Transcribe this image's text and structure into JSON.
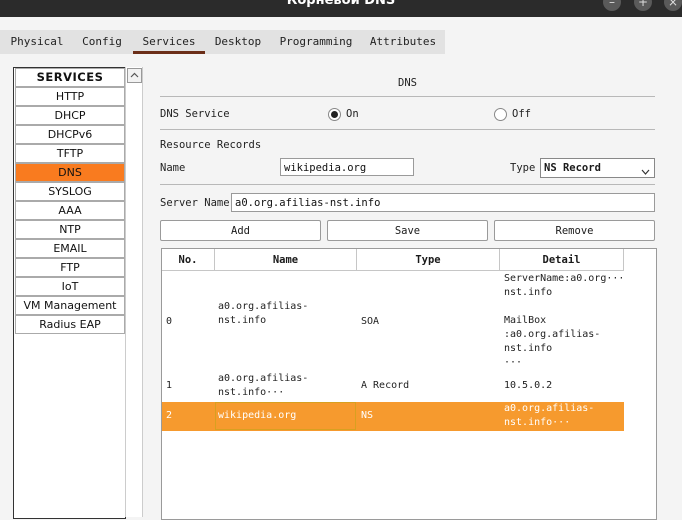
{
  "window": {
    "title": "Корневой DNS"
  },
  "tabs": [
    "Physical",
    "Config",
    "Services",
    "Desktop",
    "Programming",
    "Attributes"
  ],
  "services": {
    "header": "SERVICES",
    "items": [
      "HTTP",
      "DHCP",
      "DHCPv6",
      "TFTP",
      "DNS",
      "SYSLOG",
      "AAA",
      "NTP",
      "EMAIL",
      "FTP",
      "IoT",
      "VM Management",
      "Radius EAP"
    ],
    "selected": "DNS"
  },
  "dns": {
    "heading": "DNS",
    "service_label": "DNS Service",
    "on_label": "On",
    "off_label": "Off",
    "service_state": "On",
    "resource_records_label": "Resource Records",
    "name_label": "Name",
    "name_value": "wikipedia.org",
    "type_label": "Type",
    "type_value": "NS Record",
    "server_name_label": "Server Name",
    "server_name_value": "a0.org.afilias-nst.info",
    "add_button": "Add",
    "save_button": "Save",
    "remove_button": "Remove"
  },
  "table": {
    "columns": [
      "No.",
      "Name",
      "Type",
      "Detail"
    ],
    "rows": [
      {
        "no": "0",
        "name": "a0.org.afilias-\nnst.info",
        "type": "SOA",
        "detail": "ServerName:a0.org···\nnst.info\n\nMailBox\n:a0.org.afilias-\nnst.info\n···"
      },
      {
        "no": "1",
        "name": "a0.org.afilias-\nnst.info···",
        "type": "A Record",
        "detail": "10.5.0.2"
      },
      {
        "no": "2",
        "name": "wikipedia.org",
        "type": "NS",
        "detail": "a0.org.afilias-\nnst.info···"
      }
    ],
    "selected_row": 2
  },
  "colors": {
    "selected_service": "#f97b1f",
    "selected_row": "#f69a2e",
    "active_tab_underline": "#6b2e18"
  }
}
